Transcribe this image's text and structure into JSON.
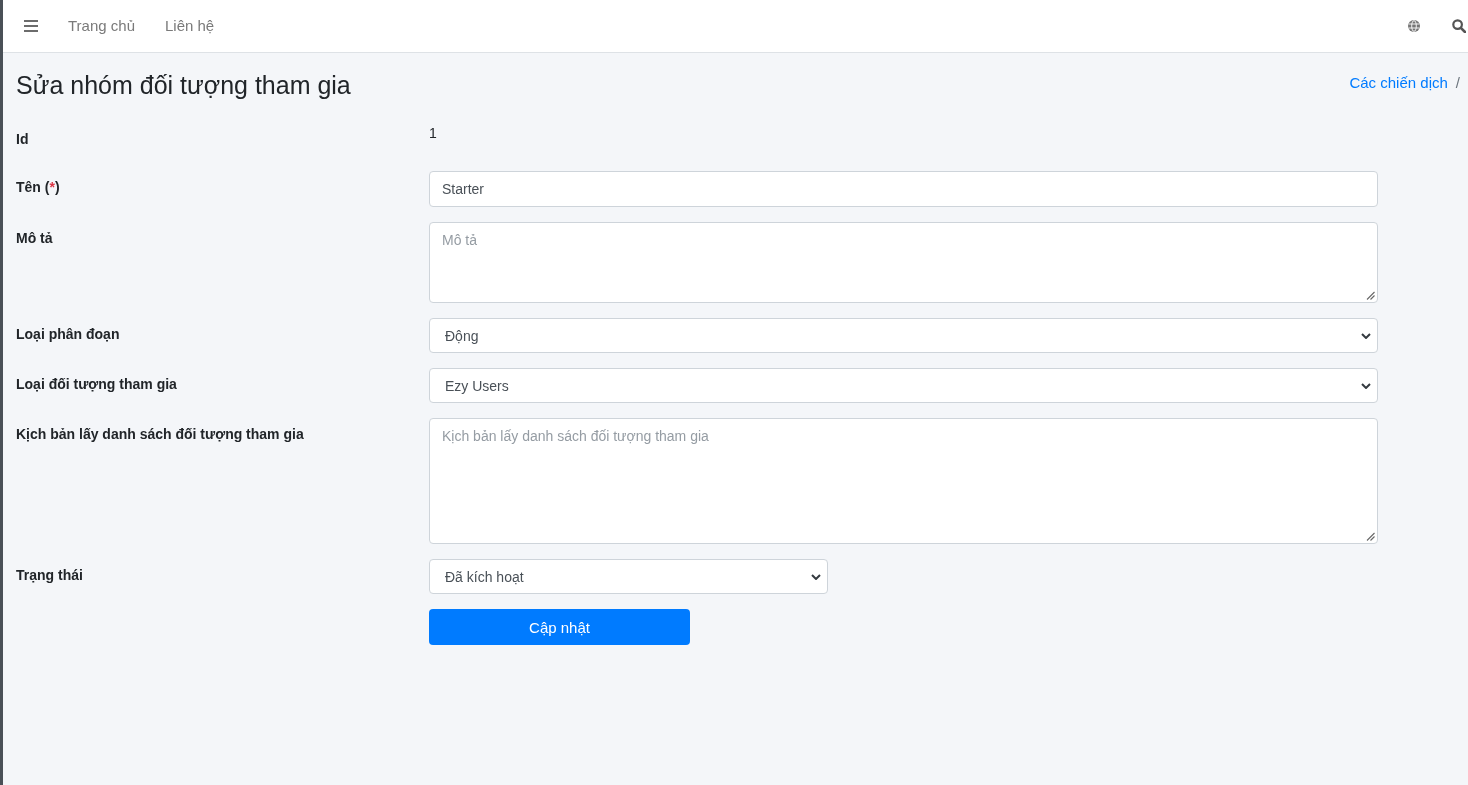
{
  "navbar": {
    "links": [
      {
        "label": "Trang chủ"
      },
      {
        "label": "Liên hệ"
      }
    ]
  },
  "page": {
    "title": "Sửa nhóm đối tượng tham gia",
    "breadcrumb": [
      {
        "label": "Các chiến dịch",
        "separator": "/"
      }
    ]
  },
  "form": {
    "fields": [
      {
        "kind": "static",
        "label": "Id",
        "value": "1"
      },
      {
        "kind": "text",
        "label": "Tên",
        "required_mark": {
          "open": "(",
          "mark": "*",
          "close": ")"
        },
        "value": "Starter"
      },
      {
        "kind": "textarea",
        "label": "Mô tả",
        "placeholder": "Mô tả"
      },
      {
        "kind": "select",
        "label": "Loại phân đoạn",
        "value": "Động"
      },
      {
        "kind": "select",
        "label": "Loại đối tượng tham gia",
        "value": "Ezy Users"
      },
      {
        "kind": "script",
        "label": "Kịch bản lấy danh sách đối tượng tham gia",
        "placeholder": "Kịch bản lấy danh sách đối tượng tham gia"
      },
      {
        "kind": "status",
        "label": "Trạng thái",
        "value": "Đã kích hoạt"
      }
    ],
    "submit_button": {
      "label": "Cập nhật"
    }
  }
}
